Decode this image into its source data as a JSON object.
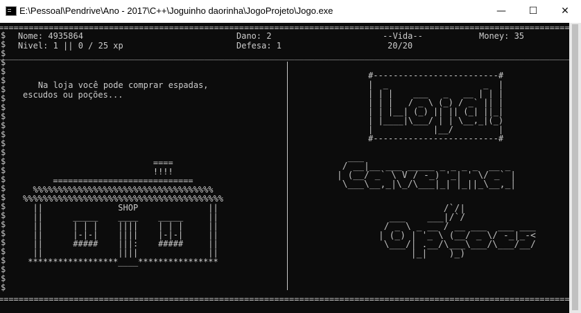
{
  "window": {
    "title": "E:\\Pessoal\\Pendrive\\Ano - 2017\\C++\\Joguinho daorinha\\JogoProjeto\\Jogo.exe",
    "minimize_glyph": "—",
    "maximize_glyph": "☐",
    "close_glyph": "✕",
    "icon": "console-app-icon"
  },
  "status": {
    "border_top": "=======================================================================================================================",
    "nome": "Nome: 4935864",
    "nivel": "Nivel: 1 || 0 / 25 xp",
    "dano": "Dano: 2",
    "defesa": "Defesa: 1",
    "vida_label": "--Vida--",
    "vida_value": "20/20",
    "money": "Money: 35",
    "rule": "_______________________________________________________________________________________________________________________"
  },
  "dollar_column": "$\n$\n$\n$\n$\n$\n$\n$\n$\n$\n$\n$\n$\n$\n$\n$\n$\n$\n$\n$\n$\n$\n$\n$\n$\n$\n$\n$\n$",
  "left_panel": {
    "message_line1": "    Na loja você pode comprar espadas,",
    "message_line2": "escudos ou poções...",
    "shop_art": "                          ====\n                          !!!!\n      ============================\n  %%%%%%%%%%%%%%%%%%%%%%%%%%%%%%%%%%%%\n%%%%%%%%%%%%%%%%%%%%%%%%%%%%%%%%%%%%%%%%\n  ||               SHOP              ||\n  ||      _____    ____    _____     ||\n  ||      | | |    ||||    | | |     ||\n  ||      |-|-|    ||||    |-|-|     ||\n  ||      #####    |||:    #####     ||\n  ||               ||||              ||\n ******************____****************"
  },
  "right_panel": {
    "loja_title": "#-------------------------#\n|  _                   _  |\n| | |    ___   _   __ | | |\n| | |   / _ \\ (_) / _` || |\n| | |__| (_) || || (_| ||_|\n| |____|\\___/ | | \\__,_|(_)\n|            |__/         |\n#-------------------------#",
    "caverna_title": "   ___\n  / __|__ ___ _____ _ _ _ _  __ _\n | (__/ _` \\ V / -_) '_| ' \\/ _` |\n  \\___\\__,_|\\_/\\___|_| |_||_\\__,_|",
    "opcoes_title": "             /`/|\n   ___    ___|/`/\n  / _ \\ _ __ / __ ___  ___ ___\n | (_) | '_ \\ (__/ _ \\/ -_|_-<\n  \\___/| .__/\\___\\___/\\___/__/\n       |_|    )_)"
  },
  "footer": {
    "border_bottom": "======================================================================================================================="
  },
  "colors": {
    "console_bg": "#0c0c0c",
    "console_fg": "#cccccc",
    "titlebar_bg": "#ffffff"
  }
}
